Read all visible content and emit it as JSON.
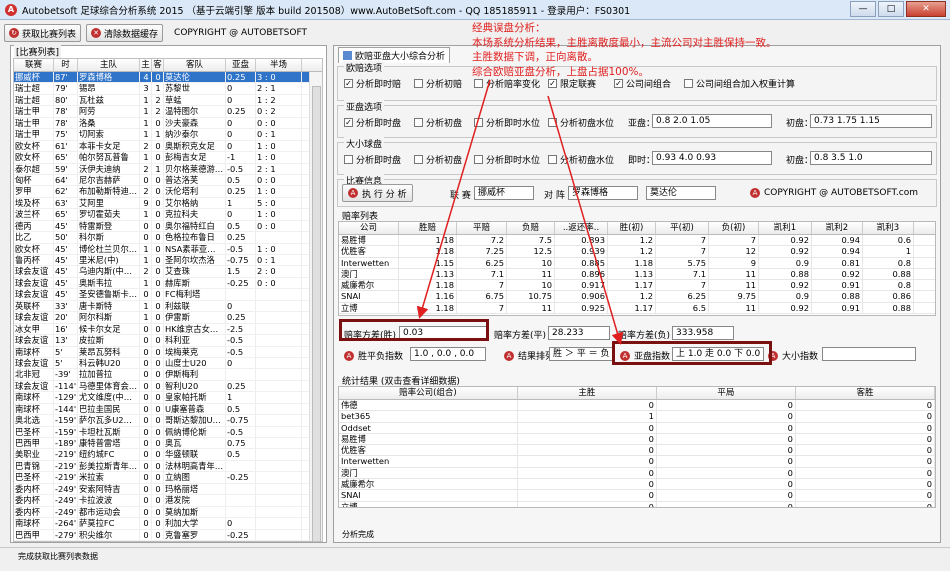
{
  "window": {
    "title": "Autobetsoft 足球综合分析系统 2015 （基于云端引擎 版本 build 201508）www.AutoBetSoft.com   - QQ 185185911   - 登录用户：FS0301",
    "min": "—",
    "max": "□",
    "close": "✕"
  },
  "toolbar": {
    "get_list": "获取比赛列表",
    "clear_cache": "清除数据缓存",
    "copyright": "COPYRIGHT @ AUTOBETSOFT"
  },
  "left": {
    "legend": "[比赛列表]",
    "headers": [
      "联赛",
      "时",
      "主队",
      "主",
      "客",
      "客队",
      "亚盘",
      "半场"
    ],
    "rows": [
      [
        "挪威杯",
        "87'",
        "罗森博格",
        "4",
        "0",
        "莫达伦",
        "0.25",
        "3 : 0"
      ],
      [
        "瑞士超",
        "79'",
        "锡昂",
        "3",
        "1",
        "苏黎世",
        "0",
        "2 : 1"
      ],
      [
        "瑞士超",
        "80'",
        "瓦杜兹",
        "1",
        "2",
        "草蜢",
        "0",
        "1 : 2"
      ],
      [
        "瑞士甲",
        "78'",
        "阿劳",
        "1",
        "2",
        "温特图尔",
        "0.25",
        "0 : 2"
      ],
      [
        "瑞士甲",
        "78'",
        "洛桑",
        "1",
        "0",
        "沙夫豪森",
        "0",
        "0 : 0"
      ],
      [
        "瑞士甲",
        "75'",
        "切阿索",
        "1",
        "1",
        "纳沙泰尔",
        "0",
        "0 : 1"
      ],
      [
        "欧女杯",
        "61'",
        "本菲卡女足",
        "2",
        "0",
        "奥斯积克女足",
        "0",
        "1 : 0"
      ],
      [
        "欧女杯",
        "65'",
        "帕尔努瓦普鲁",
        "1",
        "0",
        "彭梅吉女足",
        "-1",
        "1 : 0"
      ],
      [
        "泰尔超",
        "59'",
        "沃伊夫迪纳",
        "2",
        "1",
        "贝尔格莱德游…",
        "-0.5",
        "2 : 1"
      ],
      [
        "匈杯",
        "64'",
        "尼尔吉赫萨",
        "0",
        "0",
        "普达洛芙",
        "0.5",
        "0 : 0"
      ],
      [
        "罗甲",
        "62'",
        "布加勒斯特迪…",
        "2",
        "0",
        "沃伦塔利",
        "0.25",
        "1 : 0"
      ],
      [
        "埃及杯",
        "63'",
        "艾阿里",
        "9",
        "0",
        "艾尔格纳",
        "1",
        "5 : 0"
      ],
      [
        "波兰杯",
        "65'",
        "罗切霍茹夫",
        "1",
        "0",
        "克拉科夫",
        "0",
        "1 : 0"
      ],
      [
        "德丙",
        "45'",
        "特雷斯登",
        "0",
        "0",
        "奥尔福特红白",
        "0.5",
        "0 : 0"
      ],
      [
        "比乙",
        "50'",
        "科尔斯",
        "0",
        "0",
        "色格拉布鲁日",
        "0.25",
        ""
      ],
      [
        "欧女杯",
        "45'",
        "博伦杜兰贝尔…",
        "1",
        "0",
        "NSA素菲亚…",
        "-0.5",
        "1 : 0"
      ],
      [
        "鲁丙杯",
        "45'",
        "里米尼(中)",
        "1",
        "0",
        "圣阿尔坎杰洛",
        "-0.75",
        "0 : 1"
      ],
      [
        "球会友谊",
        "45'",
        "乌迪内斯(中…",
        "2",
        "0",
        "艾查珠",
        "1.5",
        "2 : 0"
      ],
      [
        "球会友谊",
        "45'",
        "奥斯韦拉",
        "1",
        "0",
        "赫库斯",
        "-0.25",
        "0 : 0"
      ],
      [
        "球会友谊",
        "45'",
        "圣安德鲁斯卡…",
        "0",
        "0",
        "FC梅利塔",
        "",
        ""
      ],
      [
        "英联杯",
        "33'",
        "唐卡斯特",
        "1",
        "0",
        "利兹联",
        "0",
        ""
      ],
      [
        "球会友谊",
        "20'",
        "阿尔科斯",
        "1",
        "0",
        "伊雷斯",
        "0.25",
        ""
      ],
      [
        "冰女甲",
        "16'",
        "候卡尔女足",
        "0",
        "0",
        "HK维京古女…",
        "-2.5",
        ""
      ],
      [
        "球会友谊",
        "13'",
        "皮拉斯",
        "0",
        "0",
        "科利亚",
        "-0.5",
        ""
      ],
      [
        "南球杯",
        "5'",
        "莱昂瓦努科",
        "0",
        "0",
        "埃梅莱克",
        "-0.5",
        ""
      ],
      [
        "球会友谊",
        "5'",
        "科云韩U20",
        "0",
        "0",
        "山度士U20",
        "0",
        ""
      ],
      [
        "北非冠",
        "-39'",
        "拉加普拉",
        "0",
        "0",
        "伊斯梅利",
        "",
        ""
      ],
      [
        "球会友谊",
        "-114'",
        "马德里体育会…",
        "0",
        "0",
        "智利U20",
        "0.25",
        ""
      ],
      [
        "南球杯",
        "-129'",
        "尤文维度(中…",
        "0",
        "0",
        "皇家帕托斯",
        "1",
        ""
      ],
      [
        "南球杯",
        "-144'",
        "巴拉圭国民",
        "0",
        "0",
        "U康塞普森",
        "0.5",
        ""
      ],
      [
        "奥北选",
        "-159'",
        "萨尔瓦多U2…",
        "0",
        "0",
        "哥斯达黎加U…",
        "-0.75",
        ""
      ],
      [
        "巴圣杯",
        "-159'",
        "卡坦杜瓦斯",
        "0",
        "0",
        "佩纳博伦斯",
        "-0.5",
        ""
      ],
      [
        "巴西甲",
        "-189'",
        "康特普雷塔",
        "0",
        "0",
        "奥瓦",
        "0.75",
        ""
      ],
      [
        "美职业",
        "-219'",
        "纽约城FC",
        "0",
        "0",
        "华盛顿联",
        "0.5",
        ""
      ],
      [
        "巴青锦",
        "-219'",
        "彭美拉斯青年…",
        "0",
        "0",
        "法林明高青年…",
        "",
        ""
      ],
      [
        "巴圣杯",
        "-219'",
        "米拉索",
        "0",
        "0",
        "立纳图",
        "-0.25",
        ""
      ],
      [
        "委内杯",
        "-249'",
        "安索阿特吉",
        "0",
        "0",
        "玛格丽塔",
        "",
        ""
      ],
      [
        "委内杯",
        "-249'",
        "卡拉波波",
        "0",
        "0",
        "港发院",
        "",
        ""
      ],
      [
        "委内杯",
        "-249'",
        "都市运动会",
        "0",
        "0",
        "莫纳加斯",
        "",
        ""
      ],
      [
        "南球杯",
        "-264'",
        "萨莫拉FC",
        "0",
        "0",
        "利加大学",
        "0",
        ""
      ],
      [
        "巴西甲",
        "-279'",
        "积尖维尔",
        "0",
        "0",
        "克鲁塞罗",
        "-0.25",
        ""
      ]
    ]
  },
  "tab": {
    "label": "欧赔亚盘大小综合分析"
  },
  "euro": {
    "legend": "欧赔选项",
    "opts": [
      "分析即时赔",
      "分析初赔",
      "分析赔率变化",
      "限定联赛",
      "公司间组合",
      "公司间组合加入权重计算"
    ],
    "checked": [
      "✓",
      "",
      "",
      "✓",
      "✓",
      ""
    ]
  },
  "asia": {
    "legend": "亚盘选项",
    "opts": [
      "分析即时盘",
      "分析初盘",
      "分析即时水位",
      "分析初盘水位"
    ],
    "checked": [
      "✓",
      "",
      "",
      ""
    ],
    "lbl_asia": "亚盘：",
    "asia_val": "0.8  2.0  1.05",
    "lbl_init": "初盘：",
    "init_val": "0.73  1.75  1.15"
  },
  "ou": {
    "legend": "大小球盘",
    "opts": [
      "分析即时盘",
      "分析初盘",
      "分析即时水位",
      "分析初盘水位"
    ],
    "checked": [
      "",
      "",
      "",
      ""
    ],
    "lbl_now": "即时：",
    "now_val": "0.93  4.0  0.93",
    "lbl_init": "初盘：",
    "init_val": "0.8  3.5  1.0"
  },
  "match": {
    "legend": "比赛信息",
    "run": "执 行 分 析",
    "lbl_league": "联 赛",
    "league": "挪威杯",
    "lbl_vs": "对 阵",
    "home": "罗森博格",
    "away": "莫达伦",
    "copyright": "COPYRIGHT @ AUTOBETSOFT.com"
  },
  "odds": {
    "legend": "赔率列表",
    "headers": [
      "公司",
      "胜赔",
      "平赔",
      "负赔",
      "..返还率..",
      "胜(初)",
      "平(初)",
      "负(初)",
      "凯利1",
      "凯利2",
      "凯利3"
    ],
    "rows": [
      [
        "易胜博",
        "1.18",
        "7.2",
        "7.5",
        "0.893",
        "1.2",
        "7",
        "7",
        "0.92",
        "0.94",
        "0.6"
      ],
      [
        "优胜客",
        "1.18",
        "7.25",
        "12.5",
        "0.939",
        "1.2",
        "7",
        "12",
        "0.92",
        "0.94",
        "1"
      ],
      [
        "Interwetten",
        "1.15",
        "6.25",
        "10",
        "0.885",
        "1.18",
        "5.75",
        "9",
        "0.9",
        "0.81",
        "0.8"
      ],
      [
        "澳门",
        "1.13",
        "7.1",
        "11",
        "0.896",
        "1.13",
        "7.1",
        "11",
        "0.88",
        "0.92",
        "0.88"
      ],
      [
        "威廉希尔",
        "1.18",
        "7",
        "10",
        "0.917",
        "1.17",
        "7",
        "11",
        "0.92",
        "0.91",
        "0.8"
      ],
      [
        "SNAI",
        "1.16",
        "6.75",
        "10.75",
        "0.906",
        "1.2",
        "6.25",
        "9.75",
        "0.9",
        "0.88",
        "0.86"
      ],
      [
        "立博",
        "1.18",
        "7",
        "11",
        "0.925",
        "1.17",
        "6.5",
        "11",
        "0.92",
        "0.91",
        "0.88"
      ]
    ]
  },
  "stats": {
    "lbl_var_win": "赔率方差(胜)",
    "var_win": "0.03",
    "lbl_var_draw": "赔率方差(平)",
    "var_draw": "28.233",
    "lbl_var_lose": "赔率方差(负)",
    "var_lose": "333.958",
    "lbl_win_avg": "胜平负指数",
    "win_avg": "1.0 , 0.0 , 0.0",
    "lbl_order": "结果排列",
    "order": "胜 ＞ 平 ＝ 负",
    "lbl_asia_idx": "亚盘指数",
    "asia_idx": "上 1.0 走 0.0 下 0.0",
    "lbl_ou_idx": "大小指数",
    "ou_idx": ""
  },
  "result": {
    "legend": "统计结果 (双击查看详细数据)",
    "headers": [
      "赔率公司(组合)",
      "主胜",
      "平局",
      "客胜"
    ],
    "rows": [
      [
        "伟德",
        "0",
        "0",
        "0"
      ],
      [
        "bet365",
        "1",
        "0",
        "0"
      ],
      [
        "Oddset",
        "0",
        "0",
        "0"
      ],
      [
        "易胜博",
        "0",
        "0",
        "0"
      ],
      [
        "优胜客",
        "0",
        "0",
        "0"
      ],
      [
        "Interwetten",
        "0",
        "0",
        "0"
      ],
      [
        "澳门",
        "0",
        "0",
        "0"
      ],
      [
        "威廉希尔",
        "0",
        "0",
        "0"
      ],
      [
        "SNAI",
        "0",
        "0",
        "0"
      ],
      [
        "立博",
        "0",
        "0",
        "0"
      ]
    ]
  },
  "annotation": [
    "经典误盘分析：",
    "本场系统分析结果，主胜离散度最小，主流公司对主胜保持一致。",
    "主胜数据下调，正向离散。",
    "综合欧赔亚盘分析，上盘占据100%。"
  ],
  "status": {
    "left": "完成获取比赛列表数据",
    "right": "分析完成"
  },
  "colors": {
    "annotation": "#e02020",
    "highlight": "#7a1010",
    "selected": "#3074c9"
  }
}
